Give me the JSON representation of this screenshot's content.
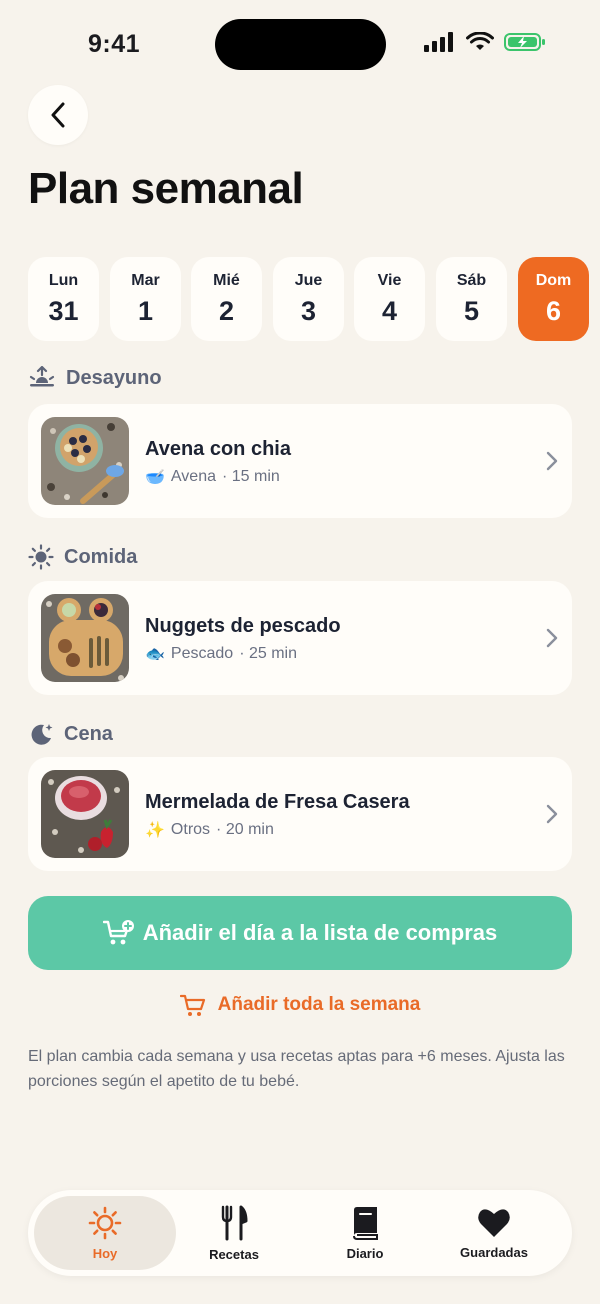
{
  "status_bar": {
    "time": "9:41"
  },
  "header": {
    "title": "Plan semanal"
  },
  "days": [
    {
      "name": "Lun",
      "num": "31"
    },
    {
      "name": "Mar",
      "num": "1"
    },
    {
      "name": "Mié",
      "num": "2"
    },
    {
      "name": "Jue",
      "num": "3"
    },
    {
      "name": "Vie",
      "num": "4"
    },
    {
      "name": "Sáb",
      "num": "5"
    },
    {
      "name": "Dom",
      "num": "6"
    }
  ],
  "meals": {
    "breakfast": {
      "section": "Desayuno",
      "title": "Avena con chia",
      "category_icon": "🥣",
      "category": "Avena",
      "time": "· 15 min"
    },
    "lunch": {
      "section": "Comida",
      "title": "Nuggets de pescado",
      "category_icon": "🐟",
      "category": "Pescado",
      "time": "· 25 min"
    },
    "dinner": {
      "section": "Cena",
      "title": "Mermelada de Fresa Casera",
      "category_icon": "✨",
      "category": "Otros",
      "time": "· 20 min"
    }
  },
  "actions": {
    "add_day": "Añadir el día a la lista de compras",
    "add_week": "Añadir toda la semana"
  },
  "note": "El plan cambia cada semana y usa recetas aptas para +6 meses. Ajusta las porciones según el apetito de tu bebé.",
  "tabbar": {
    "today": "Hoy",
    "recipes": "Recetas",
    "diary": "Diario",
    "saved": "Guardadas"
  },
  "colors": {
    "accent_orange": "#ee6a22",
    "accent_green": "#5cc8a6",
    "background": "#f7f3ec"
  }
}
